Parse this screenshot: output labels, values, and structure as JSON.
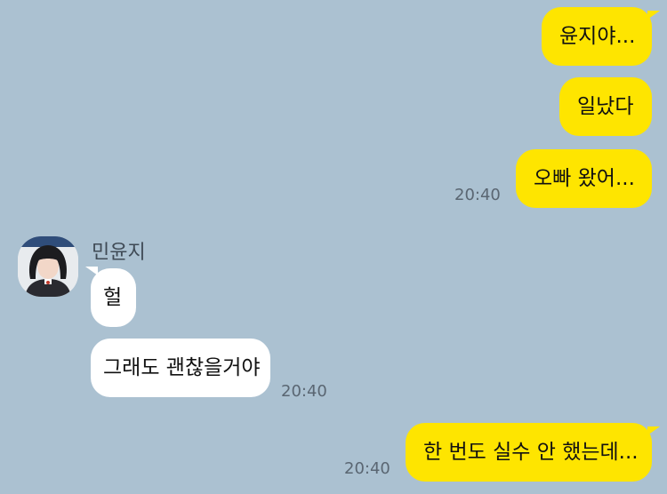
{
  "chat": {
    "sender_name": "민윤지",
    "messages_out_top": [
      {
        "text": "윤지야..."
      },
      {
        "text": "일났다"
      },
      {
        "text": "오빠 왔어...",
        "time": "20:40"
      }
    ],
    "messages_in": [
      {
        "text": "헐"
      },
      {
        "text": "그래도 괜찮을거야",
        "time": "20:40"
      }
    ],
    "messages_out_bottom": [
      {
        "text": "한 번도 실수 안 했는데...",
        "time": "20:40"
      }
    ]
  },
  "colors": {
    "background": "#abc1d1",
    "outgoing_bubble": "#fee500",
    "incoming_bubble": "#ffffff"
  },
  "icons": {
    "avatar": "profile-photo"
  }
}
